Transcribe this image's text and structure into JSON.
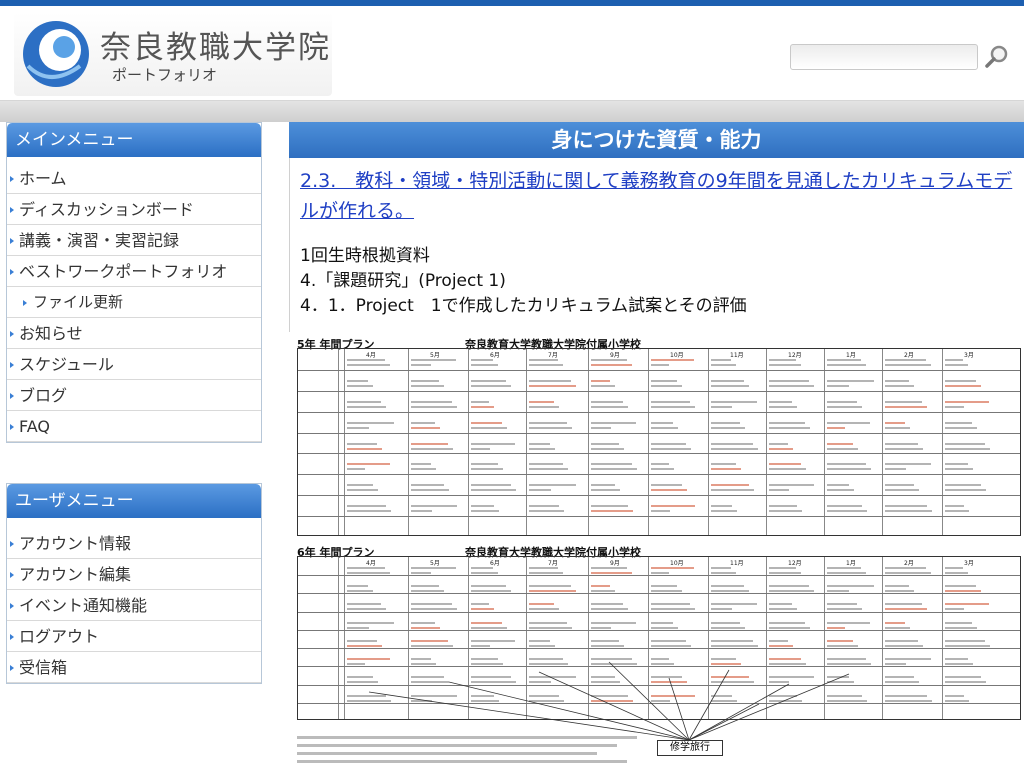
{
  "header": {
    "title": "奈良教職大学院",
    "subtitle": "ポートフォリオ",
    "search_placeholder": ""
  },
  "menus": {
    "main": {
      "title": "メインメニュー",
      "items": [
        {
          "label": "ホーム",
          "sub": false
        },
        {
          "label": "ディスカッションボード",
          "sub": false
        },
        {
          "label": "講義・演習・実習記録",
          "sub": false
        },
        {
          "label": "ベストワークポートフォリオ",
          "sub": false
        },
        {
          "label": "ファイル更新",
          "sub": true
        },
        {
          "label": "お知らせ",
          "sub": false
        },
        {
          "label": "スケジュール",
          "sub": false
        },
        {
          "label": "ブログ",
          "sub": false
        },
        {
          "label": "FAQ",
          "sub": false
        }
      ]
    },
    "user": {
      "title": "ユーザメニュー",
      "items": [
        {
          "label": "アカウント情報"
        },
        {
          "label": "アカウント編集"
        },
        {
          "label": "イベント通知機能"
        },
        {
          "label": "ログアウト"
        },
        {
          "label": "受信箱"
        }
      ]
    }
  },
  "content": {
    "heading": "身につけた資質・能力",
    "link_text": "2.3.　教科・領域・特別活動に関して義務教育の9年間を見通したカリキュラムモデルが作れる。",
    "lines": [
      "1回生時根拠資料",
      "4.「課題研究」(Project 1)",
      "4．1．Project　1で作成したカリキュラム試案とその評価"
    ]
  },
  "document": {
    "plan5_label": "5年 年間プラン",
    "plan5_school": "奈良教育大学教職大学院付属小学校",
    "plan6_label": "6年 年間プラン",
    "plan6_school": "奈良教育大学教職大学院付属小学校",
    "trip_label": "修学旅行",
    "months": [
      "4月",
      "5月",
      "6月",
      "7月",
      "9月",
      "10月",
      "11月",
      "12月",
      "1月",
      "2月",
      "3月"
    ]
  },
  "icons": {
    "logo": "swirl-logo-icon",
    "search": "magnifier-icon"
  },
  "colors": {
    "accent": "#2f6fc0",
    "link": "#1f3fc4"
  }
}
